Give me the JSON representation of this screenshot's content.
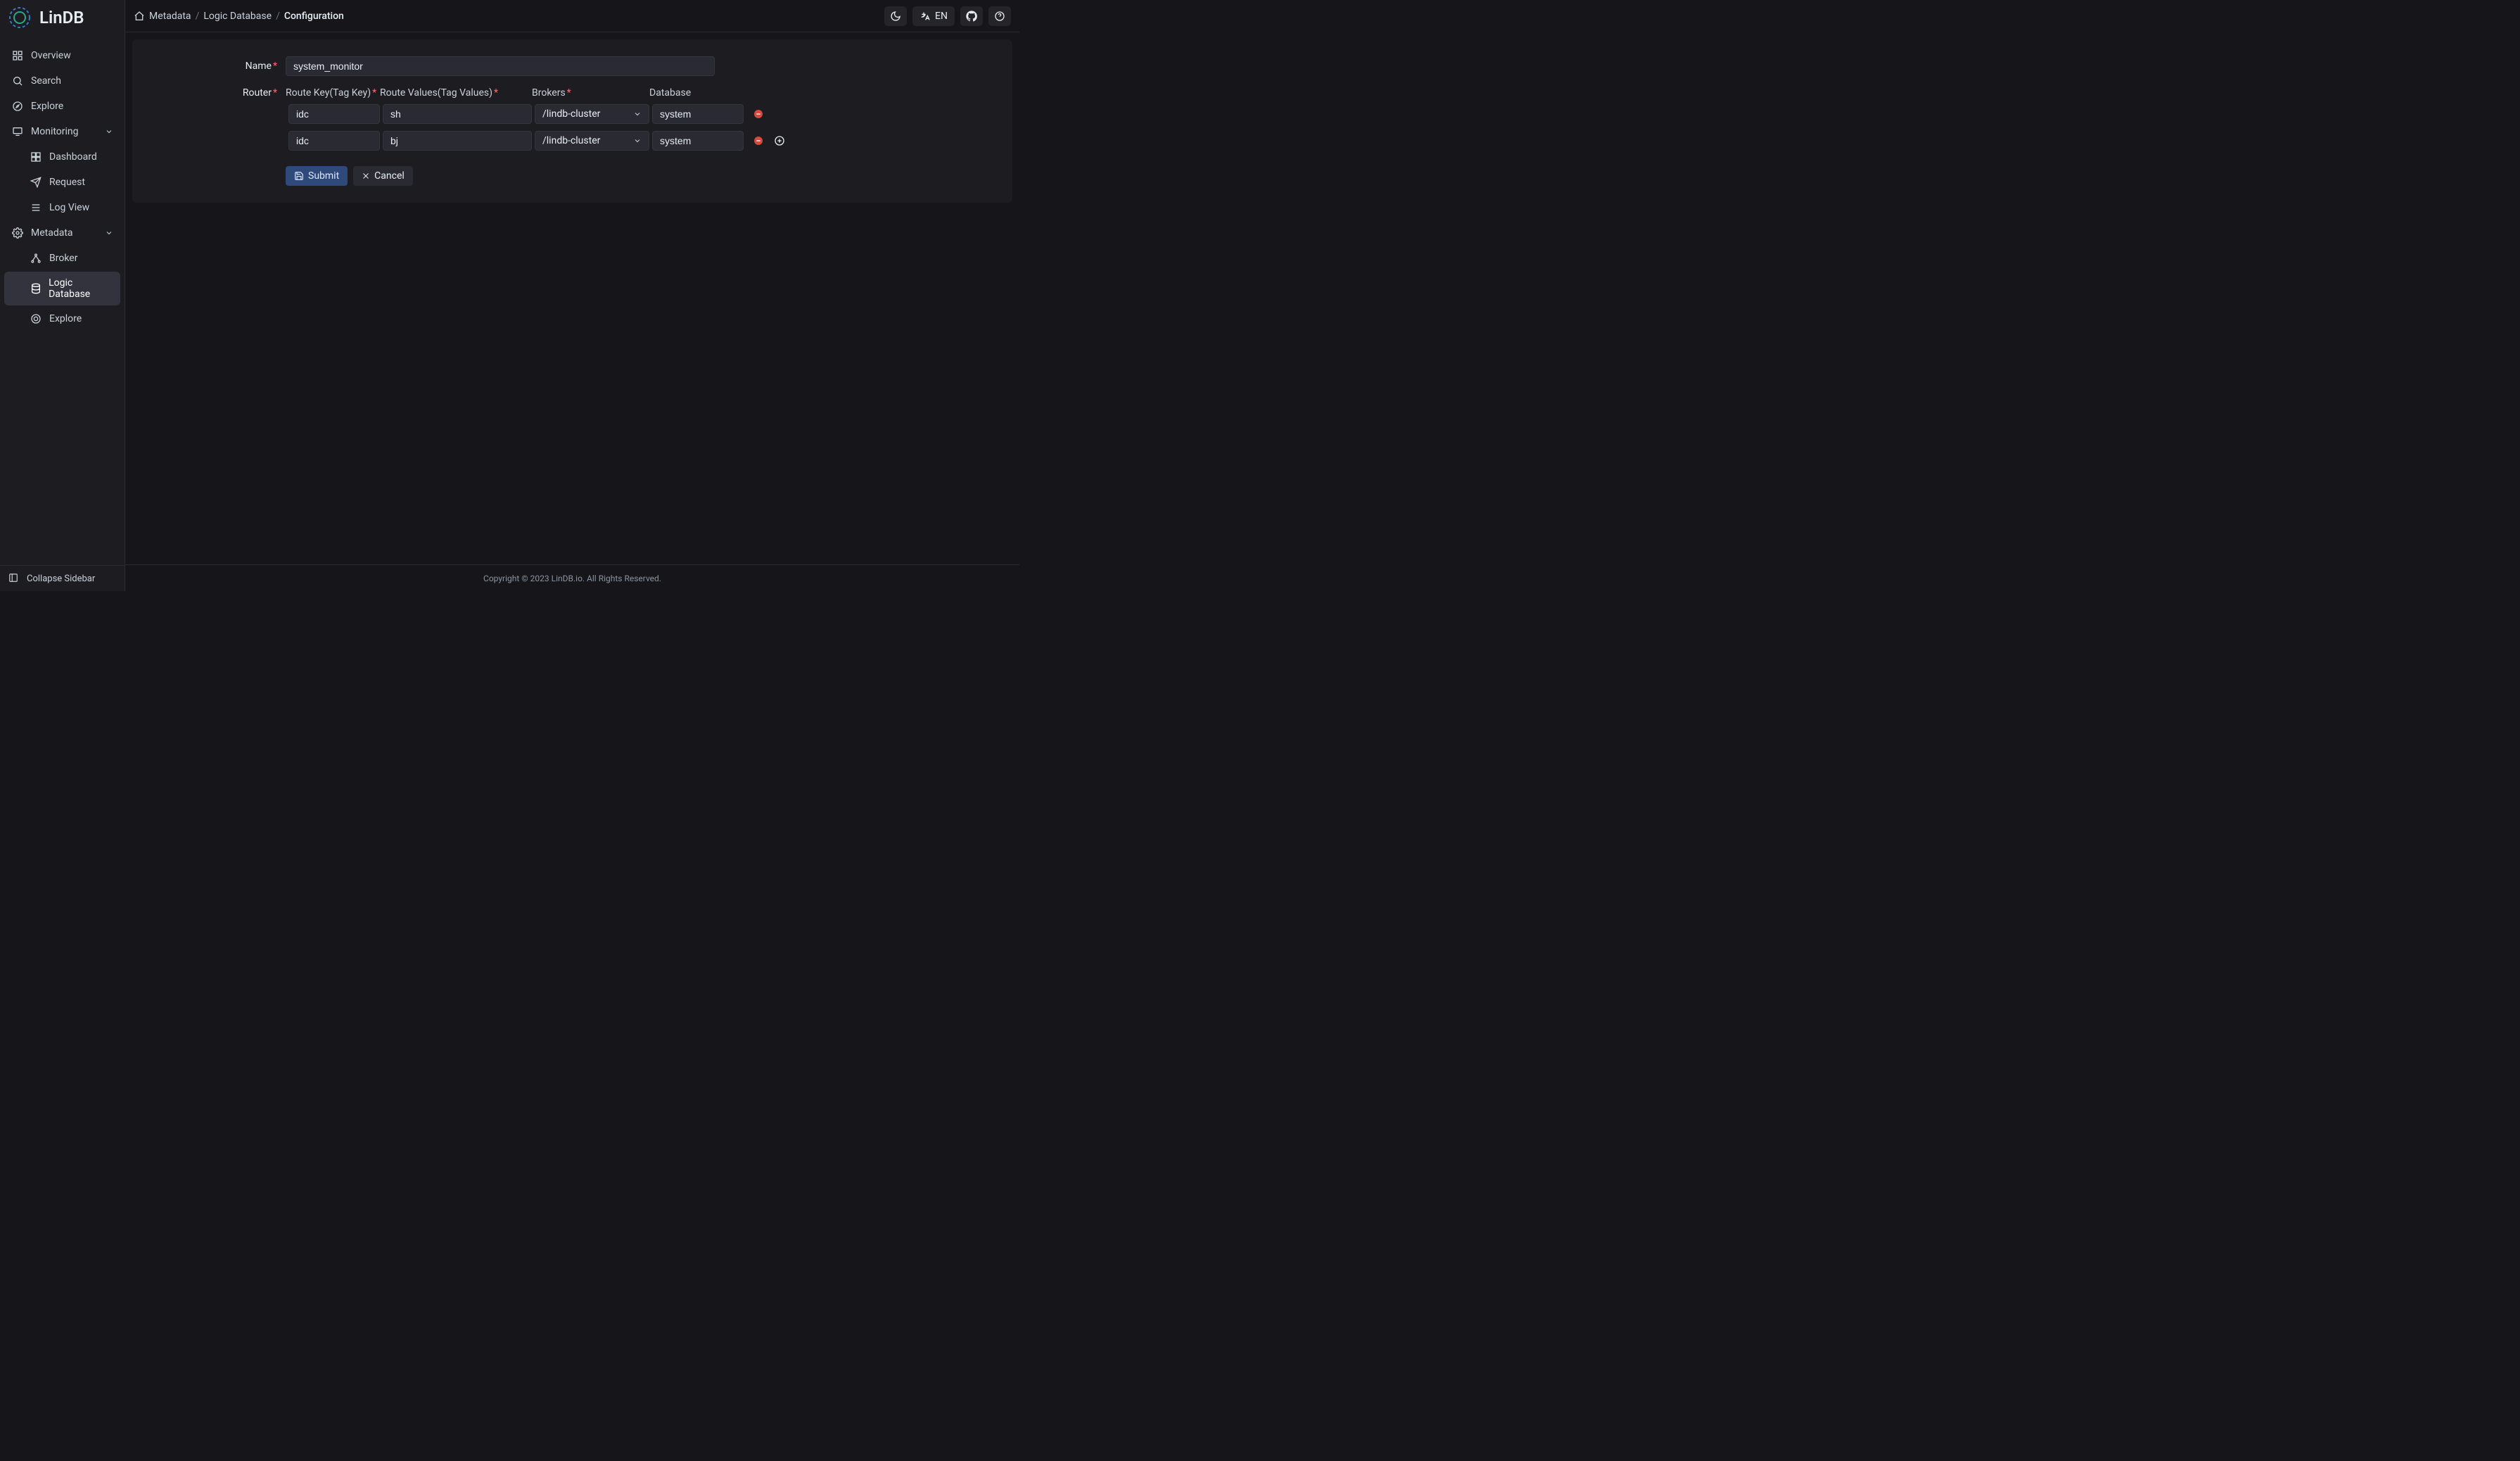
{
  "brand": {
    "name": "LinDB"
  },
  "breadcrumb": {
    "items": [
      "Metadata",
      "Logic Database"
    ],
    "current": "Configuration"
  },
  "topbar": {
    "lang": "EN"
  },
  "sidebar": {
    "items": [
      {
        "label": "Overview"
      },
      {
        "label": "Search"
      },
      {
        "label": "Explore"
      },
      {
        "label": "Monitoring"
      },
      {
        "label": "Dashboard"
      },
      {
        "label": "Request"
      },
      {
        "label": "Log View"
      },
      {
        "label": "Metadata"
      },
      {
        "label": "Broker"
      },
      {
        "label": "Logic Database"
      },
      {
        "label": "Explore"
      }
    ],
    "collapse": "Collapse Sidebar"
  },
  "form": {
    "name_label": "Name",
    "name_value": "system_monitor",
    "router_label": "Router",
    "cols": {
      "key": "Route Key(Tag Key)",
      "values": "Route Values(Tag Values)",
      "brokers": "Brokers",
      "database": "Database"
    },
    "rows": [
      {
        "key": "idc",
        "values": "sh",
        "broker": "/lindb-cluster",
        "database": "system"
      },
      {
        "key": "idc",
        "values": "bj",
        "broker": "/lindb-cluster",
        "database": "system"
      }
    ],
    "submit": "Submit",
    "cancel": "Cancel"
  },
  "footer": "Copyright © 2023 LinDB.io. All Rights Reserved."
}
